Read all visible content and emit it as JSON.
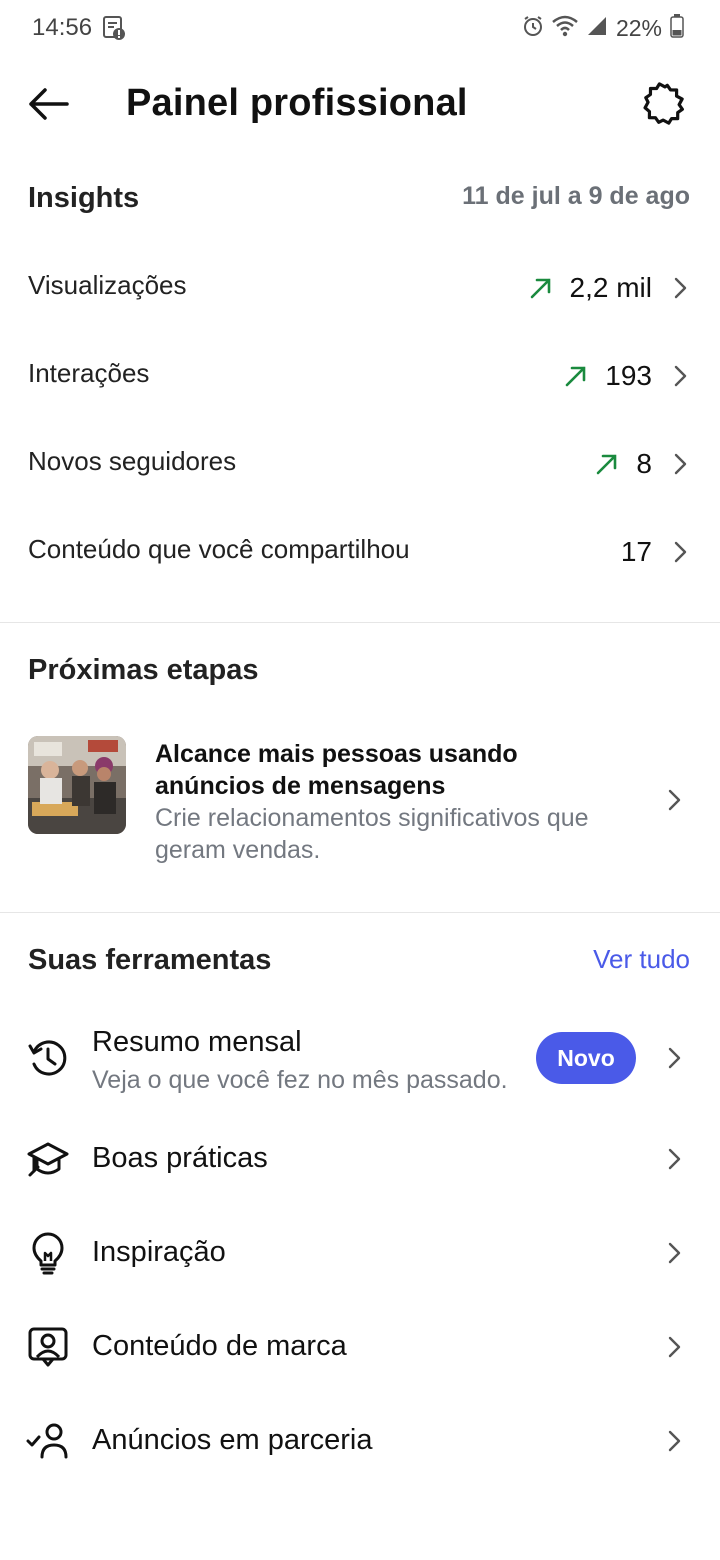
{
  "status": {
    "time": "14:56",
    "battery": "22%"
  },
  "header": {
    "title": "Painel profissional"
  },
  "insights": {
    "title": "Insights",
    "date_range": "11 de jul a 9 de ago",
    "metrics": [
      {
        "label": "Visualizações",
        "value": "2,2 mil",
        "trend": "up"
      },
      {
        "label": "Interações",
        "value": "193",
        "trend": "up"
      },
      {
        "label": "Novos seguidores",
        "value": "8",
        "trend": "up"
      },
      {
        "label": "Conteúdo que você compartilhou",
        "value": "17",
        "trend": "none"
      }
    ],
    "trend_color": "#1a8a3e"
  },
  "next_steps": {
    "title": "Próximas etapas",
    "card": {
      "title": "Alcance mais pessoas usando anúncios de mensagens",
      "description": "Crie relacionamentos significativos que geram vendas."
    }
  },
  "tools": {
    "title": "Suas ferramentas",
    "see_all": "Ver tudo",
    "accent_color": "#4a5ae8",
    "items": [
      {
        "label": "Resumo mensal",
        "subtitle": "Veja o que você fez no mês passado.",
        "badge": "Novo",
        "icon": "history-icon"
      },
      {
        "label": "Boas práticas",
        "icon": "graduation-cap-icon"
      },
      {
        "label": "Inspiração",
        "icon": "lightbulb-icon"
      },
      {
        "label": "Conteúdo de marca",
        "icon": "branded-content-icon"
      },
      {
        "label": "Anúncios em parceria",
        "icon": "partnership-ads-icon"
      }
    ]
  }
}
